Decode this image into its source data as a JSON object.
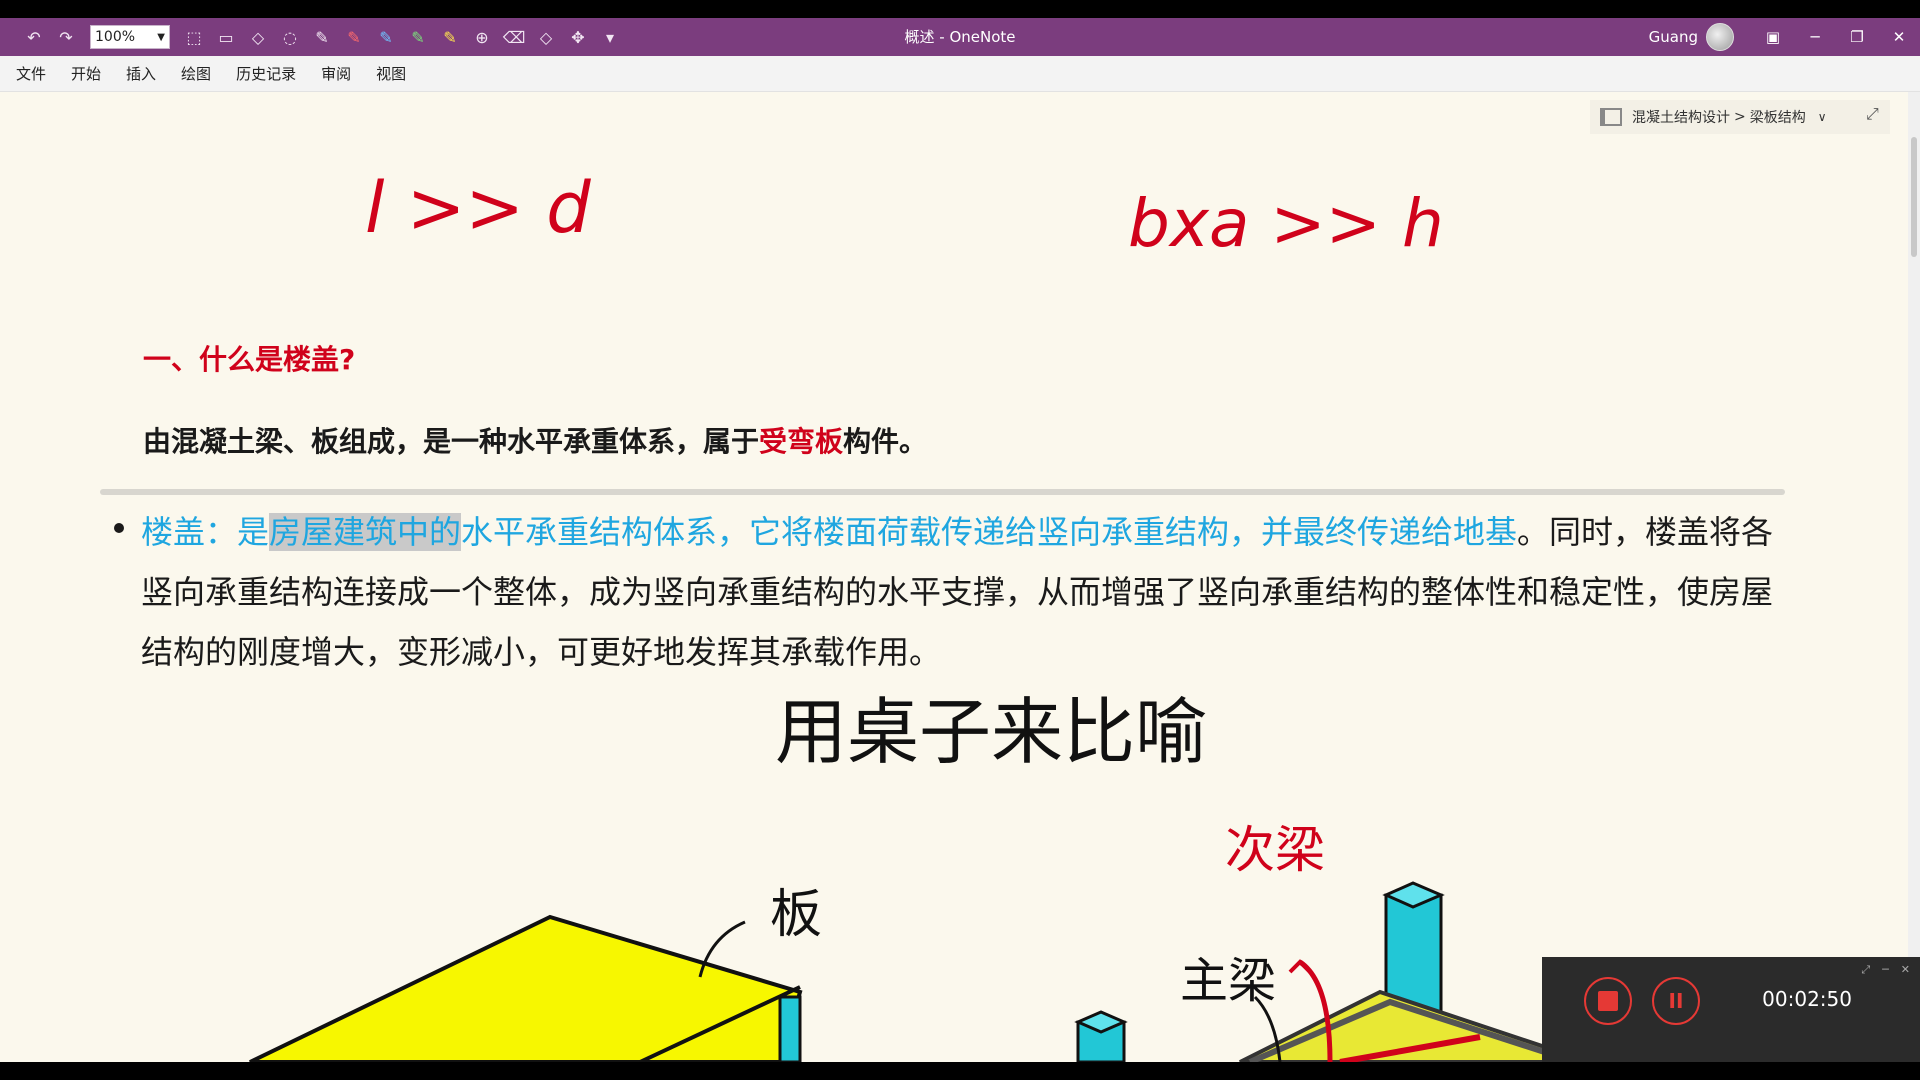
{
  "window": {
    "title": "概述 - OneNote",
    "user": "Guang",
    "zoom": "100%"
  },
  "menu": [
    "文件",
    "开始",
    "插入",
    "绘图",
    "历史记录",
    "审阅",
    "视图"
  ],
  "breadcrumb": {
    "notebook": "混凝土结构设计",
    "separator": ">",
    "section": "梁板结构"
  },
  "ink": {
    "top_left": "l >> d",
    "top_right": "bxa >> h",
    "title_note": "用桌子来比喻",
    "label_slab": "板",
    "label_secondary_beam": "次梁",
    "label_main_beam": "主梁"
  },
  "content": {
    "heading": "一、什么是楼盖?",
    "def_prefix": "由混凝土梁、板组成，是一种水平承重体系，属于",
    "def_highlight": "受弯板",
    "def_suffix": "构件。",
    "bullet_term": "楼盖：是",
    "bullet_selected": "房屋建筑中的",
    "bullet_cyan_rest": "水平承重结构体系，它将楼面荷载传递给竖向承重结构，并最终传递给地基",
    "bullet_rest": "。同时，楼盖将各竖向承重结构连接成一个整体，成为竖向承重结构的水平支撑，从而增强了竖向承重结构的整体性和稳定性，使房屋结构的刚度增大，变形减小，可更好地发挥其承载作用。"
  },
  "recorder": {
    "time": "00:02:50"
  },
  "colors": {
    "titlebar": "#7b3d7e",
    "accent_red": "#d0021b",
    "accent_cyan": "#1fa6e0",
    "page_bg": "#fbf8ed"
  }
}
